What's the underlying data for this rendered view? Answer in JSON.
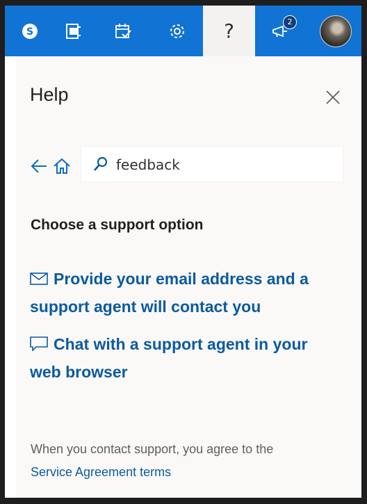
{
  "topbar": {
    "buttons": [
      {
        "icon": "skype-icon"
      },
      {
        "icon": "office-icon"
      },
      {
        "icon": "calendar-check-icon"
      },
      {
        "icon": "gear-icon"
      },
      {
        "icon": "help-icon",
        "label": "?"
      },
      {
        "icon": "megaphone-icon",
        "badge": "2"
      },
      {
        "icon": "avatar"
      }
    ]
  },
  "help": {
    "title": "Help",
    "search_value": "feedback",
    "section_title": "Choose a support option",
    "options": [
      {
        "icon": "mail-icon",
        "label": "Provide your email address and a support agent will contact you"
      },
      {
        "icon": "chat-icon",
        "label": "Chat with a support agent in your web browser"
      }
    ],
    "footer_text": "When you contact support, you agree to the",
    "footer_link": "Service Agreement terms"
  },
  "colors": {
    "topbar": "#1173d4",
    "link": "#0b5a9e",
    "panel_bg": "#faf9f8"
  }
}
